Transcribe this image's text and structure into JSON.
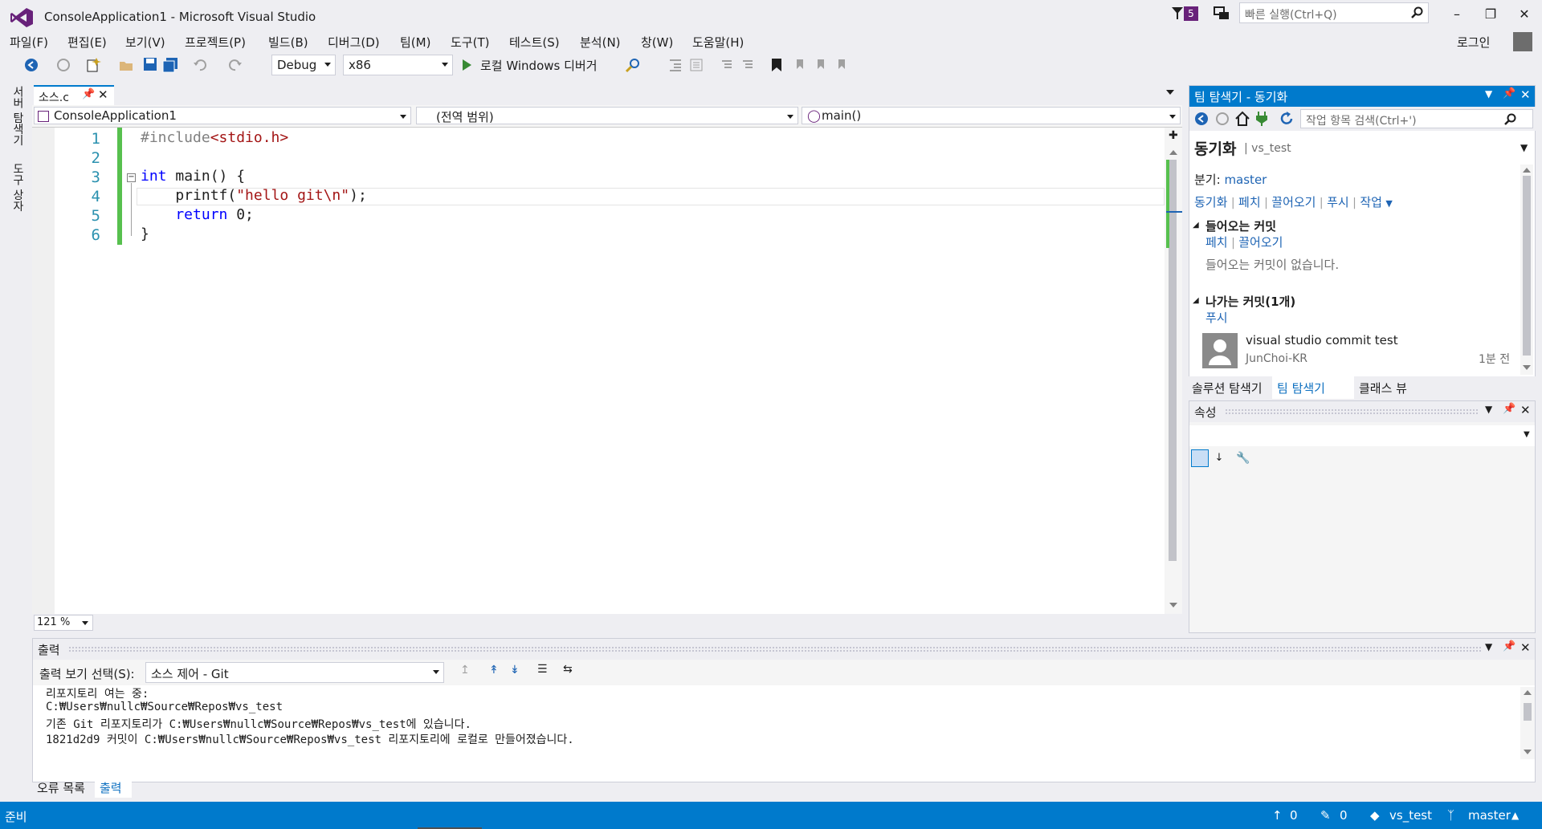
{
  "window": {
    "title": "ConsoleApplication1 - Microsoft Visual Studio",
    "notification_count": "5",
    "quick_launch_placeholder": "빠른 실행(Ctrl+Q)",
    "login": "로그인"
  },
  "menu": [
    "파일(F)",
    "편집(E)",
    "보기(V)",
    "프로젝트(P)",
    "빌드(B)",
    "디버그(D)",
    "팀(M)",
    "도구(T)",
    "테스트(S)",
    "분석(N)",
    "창(W)",
    "도움말(H)"
  ],
  "toolbar": {
    "config": "Debug",
    "platform": "x86",
    "run_label": "로컬 Windows 디버거"
  },
  "left_tabs": [
    "서버 탐색기",
    "도구 상자"
  ],
  "editor": {
    "tab_name": "소스.c",
    "nav_project": "ConsoleApplication1",
    "nav_scope": "(전역 범위)",
    "nav_member": "main()",
    "zoom": "121 %",
    "line_numbers": [
      "1",
      "2",
      "3",
      "4",
      "5",
      "6"
    ],
    "lines": [
      {
        "pre": "#include",
        "str": "<stdio.h>"
      },
      {
        "text": ""
      },
      {
        "kw": "int",
        "text": " main() {"
      },
      {
        "text": "    printf(",
        "str": "\"hello git\\n\"",
        "post": ");"
      },
      {
        "kw": "    return",
        "text": " 0;"
      },
      {
        "text": "}"
      }
    ]
  },
  "team_explorer": {
    "header": "팀 탐색기 - 동기화",
    "search_placeholder": "작업 항목 검색(Ctrl+')",
    "page_title": "동기화",
    "repo": "vs_test",
    "branch_label": "분기:",
    "branch": "master",
    "actions": [
      "동기화",
      "페치",
      "끌어오기",
      "푸시",
      "작업"
    ],
    "incoming_title": "들어오는 커밋",
    "incoming_actions": [
      "페치",
      "끌어오기"
    ],
    "incoming_empty": "들어오는 커밋이 없습니다.",
    "outgoing_title": "나가는 커밋(1개)",
    "outgoing_action": "푸시",
    "commit_message": "visual studio commit test",
    "commit_author": "JunChoi-KR",
    "commit_time": "1분 전",
    "bottom_tabs": [
      "솔루션 탐색기",
      "팀 탐색기",
      "클래스 뷰"
    ]
  },
  "properties": {
    "header": "속성"
  },
  "output": {
    "header": "출력",
    "show_label": "출력 보기 선택(S):",
    "source": "소스 제어 - Git",
    "lines": [
      "리포지토리 여는 중:",
      "C:₩Users₩nullc₩Source₩Repos₩vs_test",
      "기존 Git 리포지토리가 C:₩Users₩nullc₩Source₩Repos₩vs_test에 있습니다.",
      "1821d2d9 커밋이 C:₩Users₩nullc₩Source₩Repos₩vs_test 리포지토리에 로컬로 만들어졌습니다."
    ],
    "tabs": [
      "오류 목록",
      "출력"
    ]
  },
  "status": {
    "ready": "준비",
    "up": "0",
    "pending": "0",
    "repo": "vs_test",
    "branch": "master"
  },
  "colors": {
    "accent": "#007acc",
    "vs_purple": "#68217a",
    "green_bar": "#57c04e"
  }
}
